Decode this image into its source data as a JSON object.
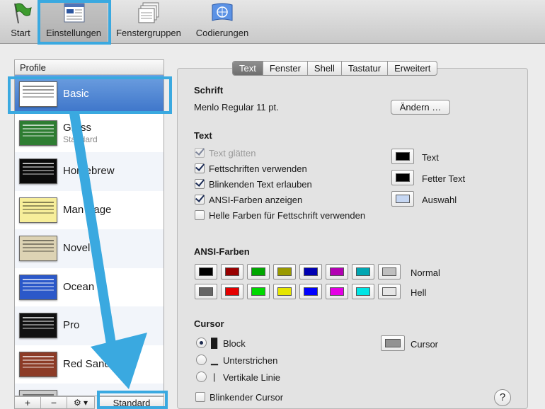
{
  "toolbar": {
    "items": [
      {
        "label": "Start",
        "icon": "flag-icon"
      },
      {
        "label": "Einstellungen",
        "icon": "settings-window-icon",
        "selected": true
      },
      {
        "label": "Fenstergruppen",
        "icon": "window-groups-icon"
      },
      {
        "label": "Codierungen",
        "icon": "un-flag-icon"
      }
    ]
  },
  "profiles": {
    "header": "Profile",
    "items": [
      {
        "name": "Basic",
        "sub": "",
        "thumb_bg": "#ffffff",
        "thumb_style": "light",
        "selected": true
      },
      {
        "name": "Grass",
        "sub": "Standard",
        "thumb_bg": "#2e7d32",
        "thumb_style": "dark"
      },
      {
        "name": "Homebrew",
        "sub": "",
        "thumb_bg": "#0a0a0a",
        "thumb_style": "dark"
      },
      {
        "name": "Man Page",
        "sub": "",
        "thumb_bg": "#f7ee9a",
        "thumb_style": "light"
      },
      {
        "name": "Novel",
        "sub": "",
        "thumb_bg": "#ddd3b4",
        "thumb_style": "light"
      },
      {
        "name": "Ocean",
        "sub": "",
        "thumb_bg": "#2b58c9",
        "thumb_style": "dark"
      },
      {
        "name": "Pro",
        "sub": "",
        "thumb_bg": "#111111",
        "thumb_style": "dark"
      },
      {
        "name": "Red Sands",
        "sub": "",
        "thumb_bg": "#8c3b26",
        "thumb_style": "dark"
      },
      {
        "name": "",
        "sub": "",
        "thumb_bg": "#cccccc",
        "thumb_style": "light"
      }
    ],
    "add_label": "+",
    "remove_label": "−",
    "gear_label": "⚙ ▾",
    "default_label": "Standard"
  },
  "tabs": [
    {
      "label": "Text",
      "active": true
    },
    {
      "label": "Fenster"
    },
    {
      "label": "Shell"
    },
    {
      "label": "Tastatur"
    },
    {
      "label": "Erweitert"
    }
  ],
  "font": {
    "title": "Schrift",
    "value": "Menlo Regular 11 pt.",
    "change_label": "Ändern …"
  },
  "text_section": {
    "title": "Text",
    "options": [
      {
        "label": "Text glätten",
        "checked": true,
        "disabled": true
      },
      {
        "label": "Fettschriften verwenden",
        "checked": true
      },
      {
        "label": "Blinkenden Text erlauben",
        "checked": true
      },
      {
        "label": "ANSI-Farben anzeigen",
        "checked": true
      },
      {
        "label": "Helle Farben für Fettschrift verwenden",
        "checked": false
      }
    ],
    "colors": [
      {
        "label": "Text",
        "color": "#000000"
      },
      {
        "label": "Fetter Text",
        "color": "#000000"
      },
      {
        "label": "Auswahl",
        "color": "#c6d7f3"
      }
    ]
  },
  "ansi": {
    "title": "ANSI-Farben",
    "normal_label": "Normal",
    "bright_label": "Hell",
    "normal": [
      "#000000",
      "#990000",
      "#00a600",
      "#999900",
      "#0000b2",
      "#b200b2",
      "#00a6b2",
      "#bfbfbf"
    ],
    "bright": [
      "#666666",
      "#e50000",
      "#00d900",
      "#e5e500",
      "#0000ff",
      "#e500e5",
      "#00e5e5",
      "#e5e5e5"
    ]
  },
  "cursor": {
    "title": "Cursor",
    "options": [
      {
        "glyph": "█",
        "label": "Block",
        "selected": true
      },
      {
        "glyph": "▁",
        "label": "Unterstrichen",
        "selected": false
      },
      {
        "glyph": "|",
        "label": "Vertikale Linie",
        "selected": false
      }
    ],
    "blink_label": "Blinkender Cursor",
    "blink_checked": false,
    "color_label": "Cursor",
    "color": "#929292"
  },
  "help_label": "?",
  "annotation_color": "#3aa9e0"
}
